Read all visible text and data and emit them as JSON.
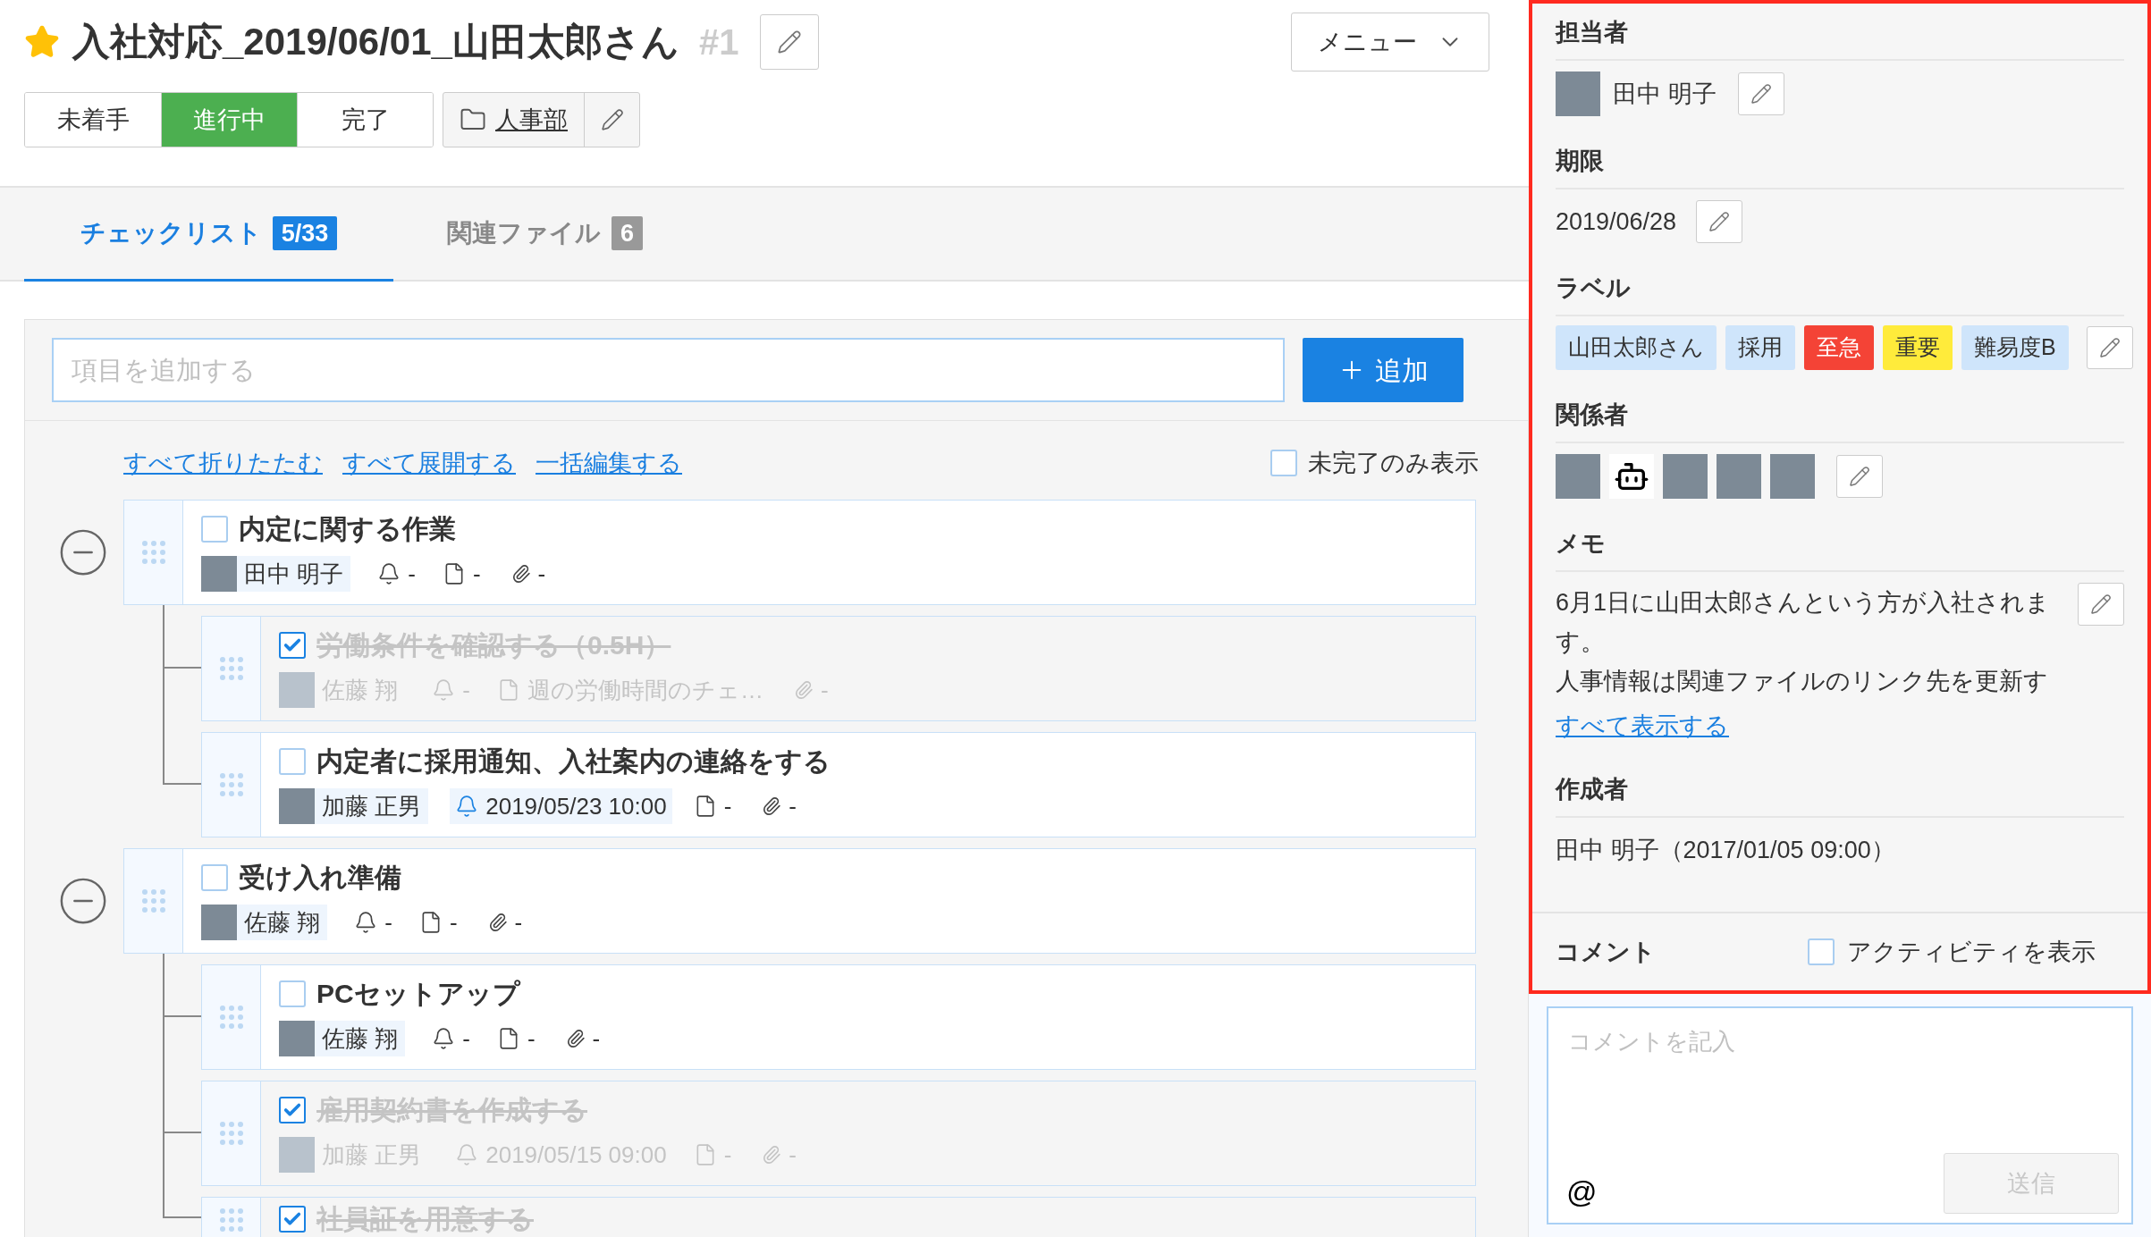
{
  "header": {
    "starred": true,
    "title": "入社対応_2019/06/01_山田太郎さん",
    "number": "#1",
    "menu": "メニュー"
  },
  "statuses": [
    {
      "label": "未着手",
      "selected": false
    },
    {
      "label": "進行中",
      "selected": true
    },
    {
      "label": "完了",
      "selected": false
    }
  ],
  "folder": "人事部",
  "tabs": [
    {
      "label": "チェックリスト",
      "count": "5/33",
      "selected": true
    },
    {
      "label": "関連ファイル",
      "count": "6",
      "selected": false
    }
  ],
  "add_item": {
    "placeholder": "項目を追加する",
    "button": "追加"
  },
  "links": [
    "すべて折りたたむ",
    "すべて展開する",
    "一括編集する"
  ],
  "incomplete_only": {
    "label": "未完了のみ表示",
    "checked": false
  },
  "checklist": [
    {
      "title": "内定に関する作業",
      "checked": false,
      "assignee": "田中 明子",
      "reminder": "-",
      "reminder_set": false,
      "note": "-",
      "attachment": "-",
      "expanded": true,
      "children": [
        {
          "title": "労働条件を確認する（0.5H）",
          "checked": true,
          "assignee": "佐藤 翔",
          "reminder": "-",
          "reminder_set": false,
          "note": "週の労働時間のチェ…",
          "attachment": "-"
        },
        {
          "title": "内定者に採用通知、入社案内の連絡をする",
          "checked": false,
          "assignee": "加藤 正男",
          "reminder": "2019/05/23 10:00",
          "reminder_set": true,
          "note": "-",
          "attachment": "-"
        }
      ]
    },
    {
      "title": "受け入れ準備",
      "checked": false,
      "assignee": "佐藤 翔",
      "reminder": "-",
      "reminder_set": false,
      "note": "-",
      "attachment": "-",
      "expanded": true,
      "children": [
        {
          "title": "PCセットアップ",
          "checked": false,
          "assignee": "佐藤 翔",
          "reminder": "-",
          "reminder_set": false,
          "note": "-",
          "attachment": "-"
        },
        {
          "title": "雇用契約書を作成する",
          "checked": true,
          "assignee": "加藤 正男",
          "reminder": "2019/05/15 09:00",
          "reminder_set": true,
          "note": "-",
          "attachment": "-"
        },
        {
          "title": "社員証を用意する",
          "checked": true
        }
      ]
    }
  ],
  "details": {
    "assignee": {
      "heading": "担当者",
      "name": "田中 明子"
    },
    "due": {
      "heading": "期限",
      "date": "2019/06/28"
    },
    "labels": {
      "heading": "ラベル",
      "items": [
        {
          "text": "山田太郎さん",
          "color": "#cfe5fb"
        },
        {
          "text": "採用",
          "color": "#cfe5fb"
        },
        {
          "text": "至急",
          "color": "#f44336"
        },
        {
          "text": "重要",
          "color": "#ffeb3b"
        },
        {
          "text": "難易度B",
          "color": "#cfe5fb"
        }
      ]
    },
    "members": {
      "heading": "関係者",
      "items": [
        {
          "kind": "photo"
        },
        {
          "kind": "robot"
        },
        {
          "kind": "photo"
        },
        {
          "kind": "photo"
        },
        {
          "kind": "photo"
        }
      ]
    },
    "memo": {
      "heading": "メモ",
      "paragraphs": [
        "6月1日に山田太郎さんという方が入社されます。",
        "人事情報は関連ファイルのリンク先を更新す"
      ],
      "show_all": "すべて表示する"
    },
    "creator": {
      "heading": "作成者",
      "text": "田中 明子（2017/01/05 09:00）"
    }
  },
  "comments": {
    "heading": "コメント",
    "activity": {
      "label": "アクティビティを表示",
      "checked": false
    },
    "placeholder": "コメントを記入",
    "mention": "@",
    "send": "送信",
    "send_disabled": true
  }
}
